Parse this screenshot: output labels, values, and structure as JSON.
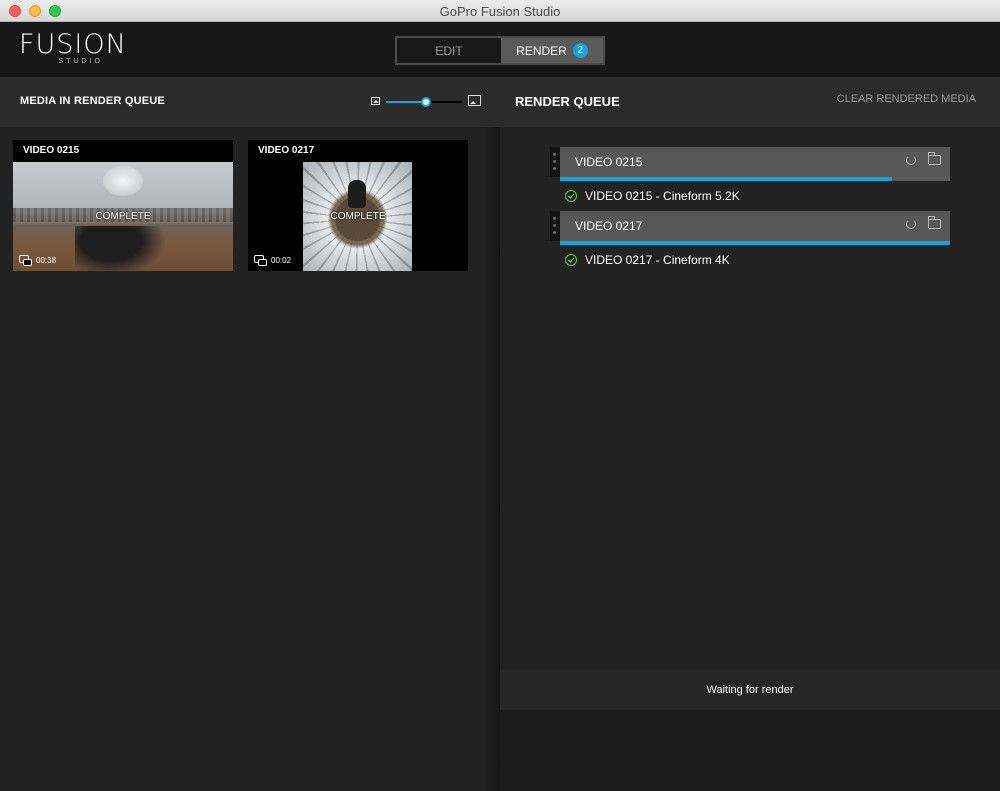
{
  "window": {
    "title": "GoPro Fusion Studio"
  },
  "logo": {
    "word": "FUSION",
    "sub": "STUDIO"
  },
  "modes": {
    "edit": "EDIT",
    "render": "RENDER",
    "render_count": "2"
  },
  "left": {
    "title": "MEDIA IN RENDER QUEUE",
    "thumb_size": 0.53,
    "media": [
      {
        "name": "VIDEO 0215",
        "status": "COMPLETE",
        "duration": "00:38"
      },
      {
        "name": "VIDEO 0217",
        "status": "COMPLETE",
        "duration": "00:02"
      }
    ]
  },
  "right": {
    "title": "RENDER QUEUE",
    "clear": "CLEAR RENDERED MEDIA",
    "jobs": [
      {
        "name": "VIDEO 0215",
        "progress": 0.85,
        "output": "VIDEO 0215 - Cineform 5.2K"
      },
      {
        "name": "VIDEO 0217",
        "progress": 1.0,
        "output": "VIDEO 0217 - Cineform 4K"
      }
    ],
    "status": "Waiting for render"
  },
  "colors": {
    "accent": "#0ca7e0",
    "success": "#5fce3a"
  }
}
